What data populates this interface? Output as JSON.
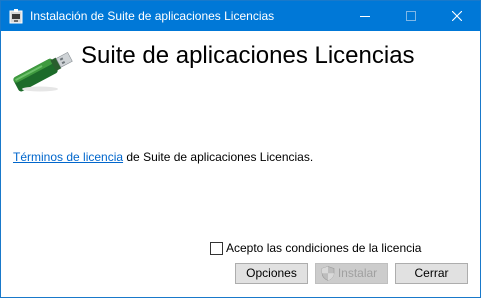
{
  "window": {
    "title": "Instalación de Suite de aplicaciones Licencias",
    "accent_color": "#0078d7"
  },
  "icons": {
    "app": "installer-icon",
    "product": "usb-dongle-icon",
    "shield": "uac-shield-icon"
  },
  "main": {
    "heading": "Suite de aplicaciones Licencias",
    "license_link": "Términos de licencia",
    "license_suffix": " de Suite de aplicaciones Licencias.",
    "accept_label": "Acepto las condiciones de la licencia",
    "accept_checked": false
  },
  "buttons": {
    "options": "Opciones",
    "install": "Instalar",
    "install_enabled": false,
    "cancel": "Cerrar"
  }
}
